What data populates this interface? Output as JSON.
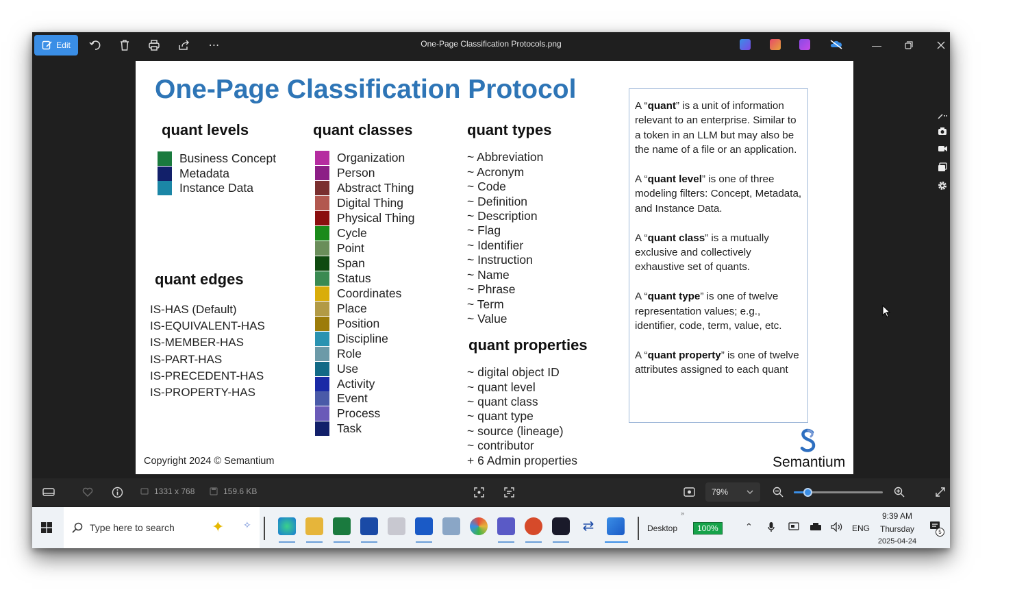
{
  "toolbar": {
    "edit_label": "Edit",
    "window_title": "One-Page Classification Protocols.png"
  },
  "slide": {
    "title": "One-Page Classification Protocol",
    "levels_heading": "quant levels",
    "levels": [
      {
        "label": "Business Concept",
        "color": "#1a7a3e"
      },
      {
        "label": "Metadata",
        "color": "#12206a"
      },
      {
        "label": "Instance Data",
        "color": "#1b86a6"
      }
    ],
    "classes_heading": "quant classes",
    "classes": [
      {
        "label": "Organization",
        "color": "#b52ca0"
      },
      {
        "label": "Person",
        "color": "#8c1e86"
      },
      {
        "label": "Abstract Thing",
        "color": "#7a2f2f"
      },
      {
        "label": "Digital Thing",
        "color": "#b2584f"
      },
      {
        "label": "Physical Thing",
        "color": "#8a0f0f"
      },
      {
        "label": "Cycle",
        "color": "#1a8a1a"
      },
      {
        "label": "Point",
        "color": "#6a8e5a"
      },
      {
        "label": "Span",
        "color": "#0f4a10"
      },
      {
        "label": "Status",
        "color": "#3a8a52"
      },
      {
        "label": "Coordinates",
        "color": "#d9ad0a"
      },
      {
        "label": "Place",
        "color": "#b29a45"
      },
      {
        "label": "Position",
        "color": "#9c7c0a"
      },
      {
        "label": "Discipline",
        "color": "#2a93b1"
      },
      {
        "label": "Role",
        "color": "#6c9aa8"
      },
      {
        "label": "Use",
        "color": "#126a86"
      },
      {
        "label": "Activity",
        "color": "#1a2aa6"
      },
      {
        "label": "Event",
        "color": "#4a5aa8"
      },
      {
        "label": "Process",
        "color": "#6a5ab8"
      },
      {
        "label": "Task",
        "color": "#12206a"
      }
    ],
    "types_heading": "quant types",
    "types": [
      "~ Abbreviation",
      "~ Acronym",
      "~ Code",
      "~ Definition",
      "~ Description",
      "~ Flag",
      "~ Identifier",
      "~ Instruction",
      "~ Name",
      "~ Phrase",
      "~ Term",
      "~ Value"
    ],
    "properties_heading": "quant properties",
    "properties": [
      "~ digital object ID",
      "~ quant level",
      "~ quant class",
      "~ quant type",
      "~ source (lineage)",
      "~ contributor",
      "+ 6 Admin properties"
    ],
    "edges_heading": "quant edges",
    "edges": [
      "IS-HAS (Default)",
      "IS-EQUIVALENT-HAS",
      "IS-MEMBER-HAS",
      "IS-PART-HAS",
      "IS-PRECEDENT-HAS",
      "IS-PROPERTY-HAS"
    ],
    "definitions": [
      {
        "pre": "A “",
        "term": "quant",
        "post": "” is a unit of information relevant to an enterprise. Similar to a token in an LLM but may also be the name of a file or an application."
      },
      {
        "pre": "A “",
        "term": "quant level",
        "post": "” is one of three modeling filters: Concept, Metadata, and Instance Data."
      },
      {
        "pre": "A “",
        "term": "quant class",
        "post": "” is a mutually exclusive and collectively exhaustive set of quants."
      },
      {
        "pre": "A “",
        "term": "quant type",
        "post": "” is one of twelve representation values; e.g., identifier, code, term, value, etc."
      },
      {
        "pre": "A “",
        "term": "quant property",
        "post": "” is one of twelve attributes assigned to each quant"
      }
    ],
    "copyright": "Copyright 2024 © Semantium",
    "brand": "Semantium"
  },
  "statusbar": {
    "dimensions": "1331 x 768",
    "filesize": "159.6 KB",
    "zoom": "79%"
  },
  "taskbar": {
    "search_placeholder": "Type here to search",
    "desktop_label": "Desktop",
    "battery": "100%",
    "lang": "ENG",
    "time": "9:39 AM",
    "day": "Thursday",
    "date": "2025-04-24",
    "notif_count": "5"
  },
  "colors": {
    "accent": "#3a8ee6",
    "title_blue": "#2e75b6"
  }
}
